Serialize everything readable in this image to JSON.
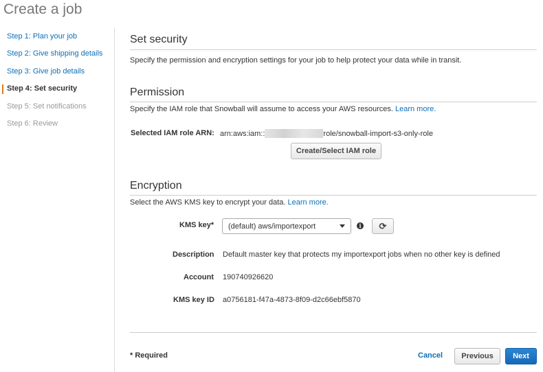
{
  "page": {
    "title": "Create a job"
  },
  "sidebar": {
    "steps": [
      {
        "label": "Step 1: Plan your job",
        "state": "done"
      },
      {
        "label": "Step 2: Give shipping details",
        "state": "done"
      },
      {
        "label": "Step 3: Give job details",
        "state": "done"
      },
      {
        "label": "Step 4: Set security",
        "state": "current"
      },
      {
        "label": "Step 5: Set notifications",
        "state": "future"
      },
      {
        "label": "Step 6: Review",
        "state": "future"
      }
    ]
  },
  "security": {
    "title": "Set security",
    "description": "Specify the permission and encryption settings for your job to help protect your data while in transit."
  },
  "permission": {
    "title": "Permission",
    "description": "Specify the IAM role that Snowball will assume to access your AWS resources.",
    "learn_more": "Learn more.",
    "role_label": "Selected IAM role ARN:",
    "role_arn_prefix": "arn:aws:iam::",
    "role_arn_suffix": "role/snowball-import-s3-only-role",
    "create_role_button": "Create/Select IAM role"
  },
  "encryption": {
    "title": "Encryption",
    "description": "Select the AWS KMS key to encrypt your data.",
    "learn_more": "Learn more.",
    "kms_key_label": "KMS key*",
    "kms_key_selected": "(default) aws/importexport",
    "info_glyph": "i",
    "refresh_glyph": "⟳",
    "description_label": "Description",
    "description_value": "Default master key that protects my importexport jobs when no other key is defined",
    "account_label": "Account",
    "account_value": "190740926620",
    "kms_key_id_label": "KMS key ID",
    "kms_key_id_value": "a0756181-f47a-4873-8f09-d2c66ebf5870"
  },
  "footer": {
    "required_note": "* Required",
    "cancel": "Cancel",
    "previous": "Previous",
    "next": "Next"
  },
  "colors": {
    "link": "#0b6fb8",
    "primary_button": "#1a73c5",
    "current_step_marker": "#e07a1f"
  },
  "icons": {
    "info": "info-circle-icon",
    "refresh": "refresh-icon",
    "dropdown": "caret-down-icon"
  }
}
